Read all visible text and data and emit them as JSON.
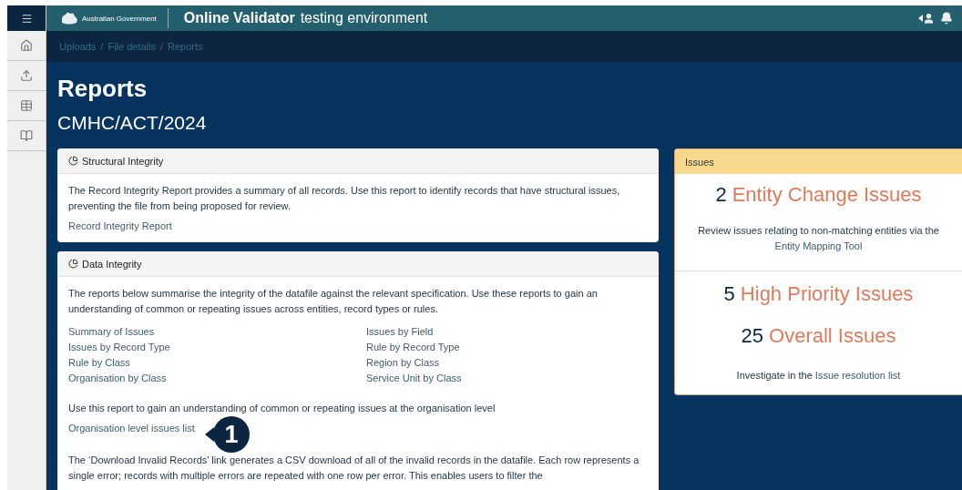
{
  "header": {
    "gov_label": "Australian Government",
    "app_name": "Online Validator",
    "environment": "testing environment"
  },
  "sidebar": {
    "items": [
      {
        "kind": "home",
        "selected": false
      },
      {
        "kind": "upload",
        "selected": false
      },
      {
        "kind": "table",
        "selected": false
      },
      {
        "kind": "book",
        "selected": false
      }
    ]
  },
  "breadcrumb": {
    "items": [
      "Uploads",
      "File details",
      "Reports"
    ],
    "separator": "/"
  },
  "page": {
    "title": "Reports",
    "subtitle": "CMHC/ACT/2024"
  },
  "structural_card": {
    "title": "Structural Integrity",
    "description": "The Record Integrity Report provides a summary of all records. Use this report to identify records that have structural issues, preventing the file from being proposed for review.",
    "link": "Record Integrity Report"
  },
  "data_card": {
    "title": "Data Integrity",
    "description": "The reports below summarise the integrity of the datafile against the relevant specification. Use these reports to gain an understanding of common or repeating issues across entities, record types or rules.",
    "links": [
      "Summary of Issues",
      "Issues by Field",
      "Issues by Record Type",
      "Rule by Record Type",
      "Rule by Class",
      "Region by Class",
      "Organisation by Class",
      "Service Unit by Class"
    ],
    "org_text": "Use this report to gain an understanding of common or repeating issues at the organisation level",
    "org_link": "Organisation level issues list",
    "callout": "1",
    "download_text": "The ‘Download Invalid Records’ link generates a CSV download of all of the invalid records in the datafile. Each row represents a single error; records with multiple errors are repeated with one row per error. This enables users to filter the"
  },
  "issues_card": {
    "title": "Issues",
    "entity": {
      "count": "2",
      "label": "Entity Change Issues"
    },
    "entity_text": "Review issues relating to non-matching entities via the",
    "entity_link": "Entity Mapping Tool",
    "stats": [
      {
        "count": "5",
        "label": "High Priority Issues"
      },
      {
        "count": "25",
        "label": "Overall Issues"
      }
    ],
    "investigate_text": "Investigate in the",
    "investigate_link": "Issue resolution list"
  }
}
